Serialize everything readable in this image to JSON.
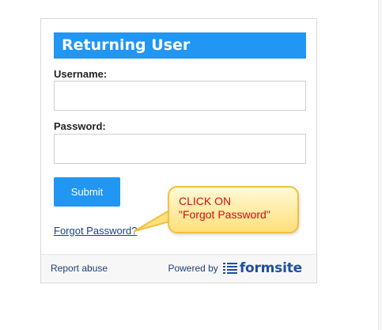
{
  "form": {
    "title": "Returning User",
    "username_label": "Username:",
    "username_value": "",
    "password_label": "Password:",
    "password_value": "",
    "submit_label": "Submit",
    "forgot_label": "Forgot Password?"
  },
  "footer": {
    "report_abuse_label": "Report abuse",
    "powered_by_label": "Powered by",
    "brand_name": "formsite",
    "brand_icon": "formsite-lines-icon"
  },
  "callout": {
    "line1": "CLICK ON",
    "line2": "\"Forgot Password\""
  },
  "colors": {
    "accent": "#2196f3",
    "link": "#1a3e8c",
    "callout_text": "#cc1111",
    "callout_fill": "#ffe07a"
  }
}
